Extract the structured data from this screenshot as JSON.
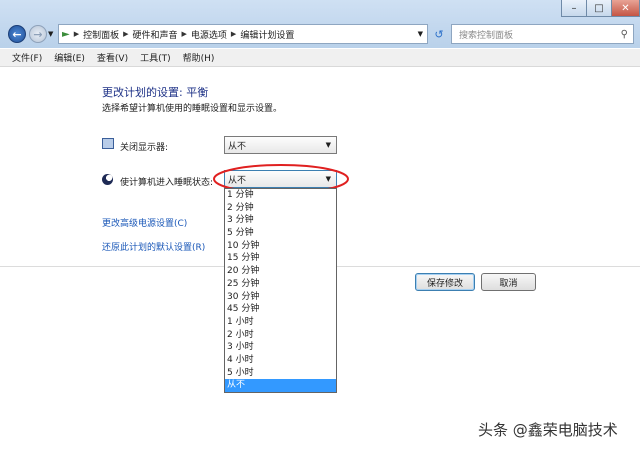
{
  "address_bar": {
    "segments": [
      "控制面板",
      "硬件和声音",
      "电源选项",
      "编辑计划设置"
    ]
  },
  "search": {
    "placeholder": "搜索控制面板"
  },
  "menu": [
    "文件(F)",
    "编辑(E)",
    "查看(V)",
    "工具(T)",
    "帮助(H)"
  ],
  "page": {
    "title": "更改计划的设置: 平衡",
    "subtitle": "选择希望计算机使用的睡眠设置和显示设置。"
  },
  "settings": {
    "display_off": {
      "label": "关闭显示器:",
      "value": "从不"
    },
    "sleep": {
      "label": "使计算机进入睡眠状态:",
      "value": "从不"
    }
  },
  "sleep_options": [
    "1 分钟",
    "2 分钟",
    "3 分钟",
    "5 分钟",
    "10 分钟",
    "15 分钟",
    "20 分钟",
    "25 分钟",
    "30 分钟",
    "45 分钟",
    "1 小时",
    "2 小时",
    "3 小时",
    "4 小时",
    "5 小时",
    "从不"
  ],
  "sleep_selected": "从不",
  "links": {
    "advanced": "更改高级电源设置(C)",
    "restore": "还原此计划的默认设置(R)"
  },
  "buttons": {
    "save": "保存修改",
    "cancel": "取消"
  },
  "watermark": "头条 @鑫荣电脑技术",
  "colors": {
    "title": "#1e3287",
    "link": "#1b58b8",
    "highlight": "#3399ff",
    "annotation": "#e02020"
  }
}
